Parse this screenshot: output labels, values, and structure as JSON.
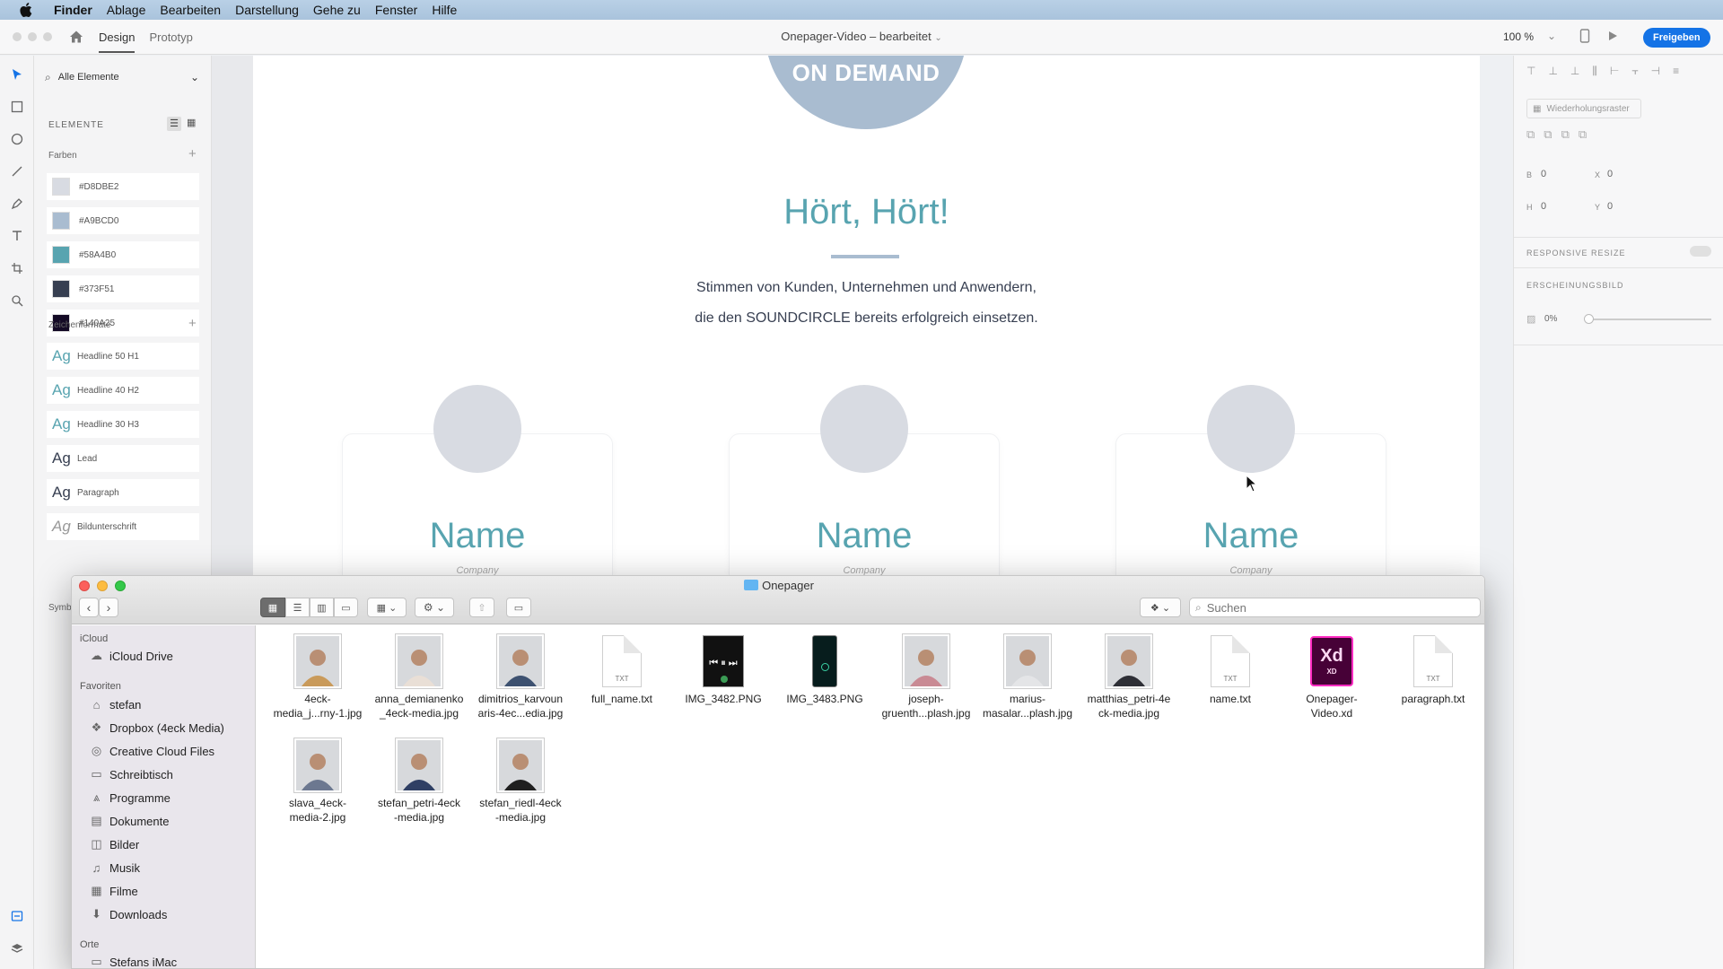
{
  "menubar": {
    "items": [
      "Finder",
      "Ablage",
      "Bearbeiten",
      "Darstellung",
      "Gehe zu",
      "Fenster",
      "Hilfe"
    ]
  },
  "xd": {
    "tabs": [
      "Design",
      "Prototyp"
    ],
    "doc_title": "Onepager-Video – bearbeitet",
    "zoom": "100 %",
    "share_label": "Freigeben"
  },
  "assets": {
    "filter_label": "Alle Elemente",
    "elements_head": "ELEMENTE",
    "colors_head": "Farben",
    "colors": [
      {
        "hex": "#D8DBE2",
        "color": "#D8DBE2"
      },
      {
        "hex": "#A9BCD0",
        "color": "#A9BCD0"
      },
      {
        "hex": "#58A4B0",
        "color": "#58A4B0"
      },
      {
        "hex": "#373F51",
        "color": "#373F51"
      },
      {
        "hex": "#140A25",
        "color": "#140A25"
      }
    ],
    "charstyles_head": "Zeichenformate",
    "charstyles": [
      {
        "ag": "Ag",
        "label": "Headline 50 H1",
        "color": "#58A4B0"
      },
      {
        "ag": "Ag",
        "label": "Headline 40 H2",
        "color": "#58A4B0"
      },
      {
        "ag": "Ag",
        "label": "Headline 30 H3",
        "color": "#58A4B0"
      },
      {
        "ag": "Ag",
        "label": "Lead",
        "color": "#373F51"
      },
      {
        "ag": "Ag",
        "label": "Paragraph",
        "color": "#373F51"
      },
      {
        "ag": "Ag",
        "label": "Bildunterschrift",
        "color": "#999999"
      }
    ],
    "symbols_head": "Symb"
  },
  "artboard": {
    "ondemand": "ON DEMAND",
    "title": "Hört, Hört!",
    "text_line1": "Stimmen von Kunden, Unternehmen und Anwendern,",
    "text_line2": "die den SOUNDCIRCLE bereits erfolgreich einsetzen.",
    "cards": [
      {
        "name": "Name",
        "company": "Company"
      },
      {
        "name": "Name",
        "company": "Company"
      },
      {
        "name": "Name",
        "company": "Company"
      }
    ]
  },
  "inspector": {
    "repeat_grid": "Wiederholungsraster",
    "w_label": "B",
    "w_val": "0",
    "x_label": "X",
    "x_val": "0",
    "h_label": "H",
    "h_val": "0",
    "y_label": "Y",
    "y_val": "0",
    "responsive": "RESPONSIVE RESIZE",
    "appearance": "ERSCHEINUNGSBILD",
    "opacity": "0%"
  },
  "finder": {
    "title": "Onepager",
    "search_placeholder": "Suchen",
    "sidebar": {
      "icloud_head": "iCloud",
      "icloud_items": [
        {
          "label": "iCloud Drive",
          "icon": "cloud-icon"
        }
      ],
      "fav_head": "Favoriten",
      "fav_items": [
        {
          "label": "stefan",
          "icon": "home-icon"
        },
        {
          "label": "Dropbox (4eck Media)",
          "icon": "dropbox-icon"
        },
        {
          "label": "Creative Cloud Files",
          "icon": "creative-cloud-icon"
        },
        {
          "label": "Schreibtisch",
          "icon": "desktop-icon"
        },
        {
          "label": "Programme",
          "icon": "applications-icon"
        },
        {
          "label": "Dokumente",
          "icon": "documents-icon"
        },
        {
          "label": "Bilder",
          "icon": "pictures-icon"
        },
        {
          "label": "Musik",
          "icon": "music-icon"
        },
        {
          "label": "Filme",
          "icon": "movies-icon"
        },
        {
          "label": "Downloads",
          "icon": "downloads-icon"
        }
      ],
      "places_head": "Orte",
      "places_items": [
        {
          "label": "Stefans iMac",
          "icon": "computer-icon"
        }
      ]
    },
    "files": [
      {
        "line1": "4eck-",
        "line2": "media_j...rny-1.jpg",
        "kind": "photo",
        "tone": "#c99a5a"
      },
      {
        "line1": "anna_demianenko",
        "line2": "_4eck-media.jpg",
        "kind": "photo",
        "tone": "#e9dfd6"
      },
      {
        "line1": "dimitrios_karvoun",
        "line2": "aris-4ec...edia.jpg",
        "kind": "photo",
        "tone": "#3d5170"
      },
      {
        "line1": "full_name.txt",
        "line2": "",
        "kind": "txt"
      },
      {
        "line1": "IMG_3482.PNG",
        "line2": "",
        "kind": "phone"
      },
      {
        "line1": "IMG_3483.PNG",
        "line2": "",
        "kind": "phone2"
      },
      {
        "line1": "joseph-",
        "line2": "gruenth...plash.jpg",
        "kind": "photo",
        "tone": "#c98a94"
      },
      {
        "line1": "marius-",
        "line2": "masalar...plash.jpg",
        "kind": "photo",
        "tone": "#e4e5e7"
      },
      {
        "line1": "matthias_petri-4e",
        "line2": "ck-media.jpg",
        "kind": "photo",
        "tone": "#2e2f36"
      },
      {
        "line1": "name.txt",
        "line2": "",
        "kind": "txt"
      },
      {
        "line1": "Onepager-",
        "line2": "Video.xd",
        "kind": "xd"
      },
      {
        "line1": "paragraph.txt",
        "line2": "",
        "kind": "txt"
      },
      {
        "line1": "slava_4eck-",
        "line2": "media-2.jpg",
        "kind": "photo",
        "tone": "#6c7890"
      },
      {
        "line1": "stefan_petri-4eck",
        "line2": "-media.jpg",
        "kind": "photo",
        "tone": "#2f3f64"
      },
      {
        "line1": "stefan_riedl-4eck",
        "line2": "-media.jpg",
        "kind": "photo",
        "tone": "#1f1f1f"
      }
    ]
  }
}
